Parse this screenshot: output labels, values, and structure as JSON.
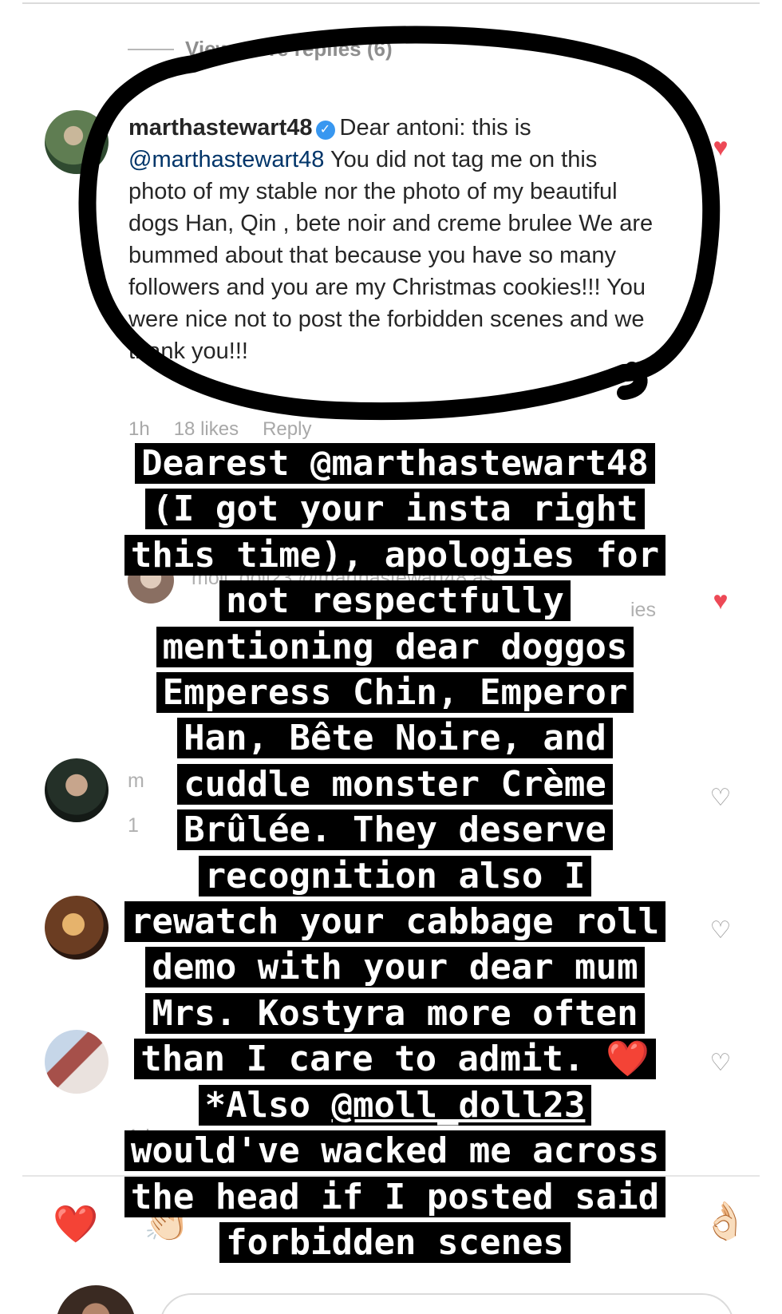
{
  "thread": {
    "view_more_replies": "View more replies (6)"
  },
  "comment": {
    "username": "marthastewart48",
    "text_intro": "Dear antoni: this is",
    "mention": "@marthastewart48",
    "text_body": "You did not tag me on this photo of my stable nor the photo of my beautiful dogs Han, Qin , bete noir and creme brulee  We are bummed about that because you have so many followers and you are my Christmas cookies!!! You  were nice not to post the forbidden scenes and we thank you!!!",
    "time": "1h",
    "likes": "18 likes",
    "reply": "Reply"
  },
  "faint_background": {
    "r2_line": "moll_doll23 @marthastewart48 as",
    "r2_tail": "ies",
    "r3_user": "m",
    "r3_time": "1",
    "r5_time": "1d"
  },
  "overlay": {
    "lines": [
      "Dearest @marthastewart48",
      "(I got your insta right",
      "this time), apologies for",
      "not respectfully",
      "mentioning dear doggos",
      "Emperess Chin, Emperor",
      "Han, Bête Noire, and",
      "cuddle monster Crème",
      "Brûlée. They deserve",
      "recognition also I",
      "rewatch your cabbage roll",
      "demo with your dear mum",
      "Mrs. Kostyra more often",
      "than I care to admit."
    ],
    "heart_emoji": "❤️",
    "also_prefix": "*Also",
    "also_mention": "@moll_doll23",
    "closing_lines": [
      "would've wacked me across",
      "the head if I posted said",
      "forbidden scenes"
    ]
  },
  "quick_reactions": {
    "heart": "❤️",
    "hand": "👏🏻",
    "ok": "👌🏻"
  },
  "colors": {
    "like_red": "#ed4956",
    "verified_blue": "#3897f0",
    "mention_blue": "#003569",
    "meta_gray": "#a8a8a8",
    "overlay_bg": "#000000",
    "overlay_text": "#ffffff"
  }
}
